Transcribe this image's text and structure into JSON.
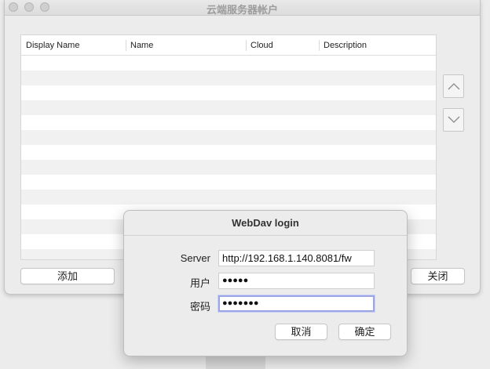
{
  "window": {
    "title": "云端服务器帐户"
  },
  "table": {
    "columns": [
      "Display Name",
      "Name",
      "Cloud",
      "Description"
    ],
    "row_count": 14
  },
  "buttons": {
    "add": "添加",
    "close": "关闭"
  },
  "dialog": {
    "title": "WebDav login",
    "server_label": "Server",
    "server_value": "http://192.168.1.140.8081/fw",
    "user_label": "用户",
    "user_value": "●●●●●",
    "password_label": "密码",
    "password_value": "●●●●●●●",
    "cancel_label": "取消",
    "ok_label": "确定"
  },
  "icons": {
    "up": "chevron-up-icon",
    "down": "chevron-down-icon"
  }
}
